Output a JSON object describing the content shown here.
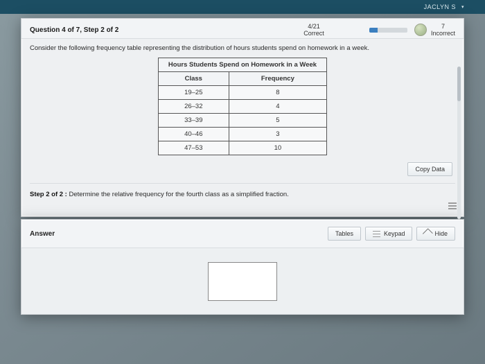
{
  "topbar": {
    "user": "JACLYN S"
  },
  "header": {
    "question_label": "Question 4 of 7,  Step 2 of 2",
    "correct_count": "4/21",
    "correct_label": "Correct",
    "incorrect_count": "7",
    "incorrect_label": "Incorrect"
  },
  "prompt": "Consider the following frequency table representing the distribution of hours students spend on homework in a week.",
  "table": {
    "title": "Hours Students Spend on Homework in a Week",
    "col_class": "Class",
    "col_freq": "Frequency",
    "rows": [
      {
        "class": "19–25",
        "freq": "8"
      },
      {
        "class": "26–32",
        "freq": "4"
      },
      {
        "class": "33–39",
        "freq": "5"
      },
      {
        "class": "40–46",
        "freq": "3"
      },
      {
        "class": "47–53",
        "freq": "10"
      }
    ]
  },
  "buttons": {
    "copy": "Copy Data",
    "tables": "Tables",
    "keypad": "Keypad",
    "hide": "Hide"
  },
  "step": {
    "prefix": "Step 2 of 2 :",
    "text": "  Determine the relative frequency for the fourth class as a simplified fraction."
  },
  "answer": {
    "label": "Answer"
  }
}
